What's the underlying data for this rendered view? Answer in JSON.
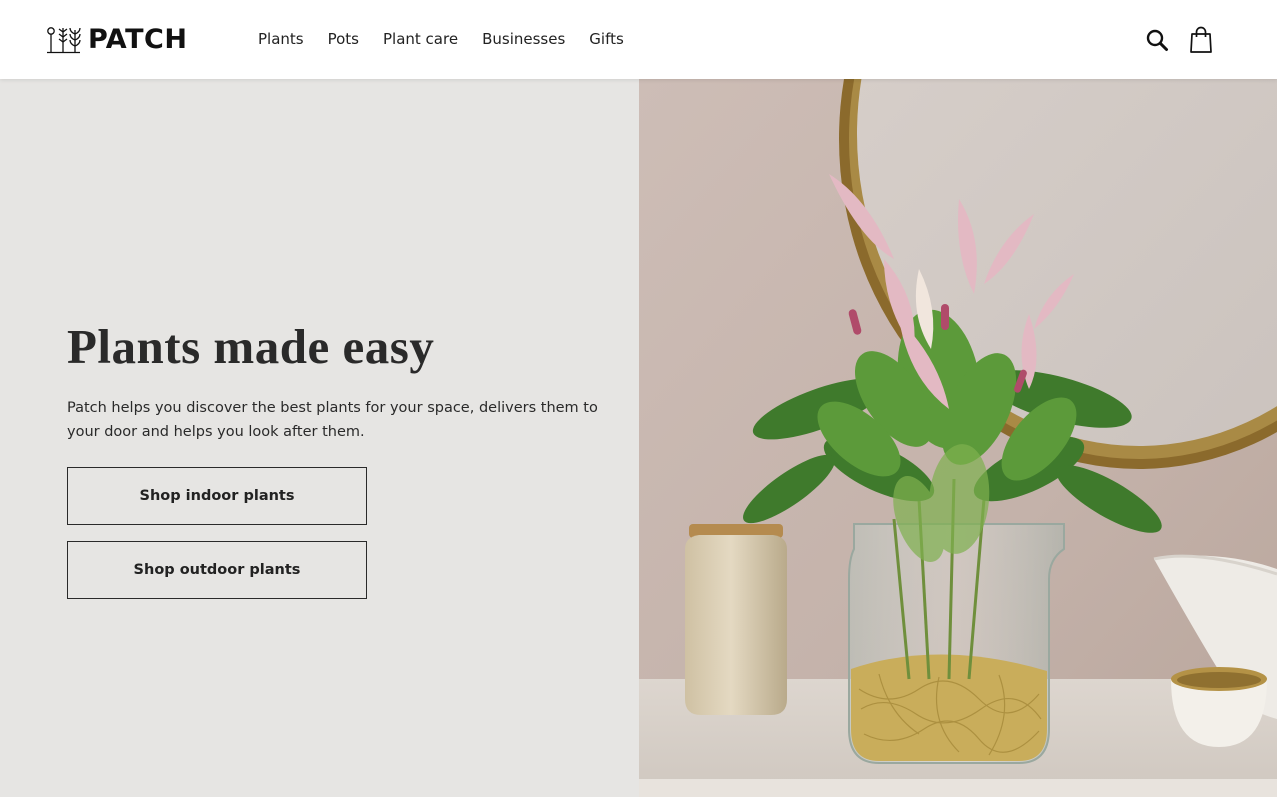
{
  "brand": {
    "name": "PATCH"
  },
  "nav": {
    "items": [
      "Plants",
      "Pots",
      "Plant care",
      "Businesses",
      "Gifts"
    ]
  },
  "header_icons": {
    "search": "search-icon",
    "bag": "shopping-bag-icon"
  },
  "hero": {
    "title": "Plants made easy",
    "description": "Patch helps you discover the best plants for your space, delivers them to your door and helps you look after them.",
    "buttons": {
      "indoor": "Shop indoor plants",
      "outdoor": "Shop outdoor plants"
    },
    "image_subject": "anthurium plant in glass vase"
  },
  "colors": {
    "hero_background": "#e6e5e3",
    "text": "#2a2a2a",
    "header_background": "#ffffff"
  }
}
